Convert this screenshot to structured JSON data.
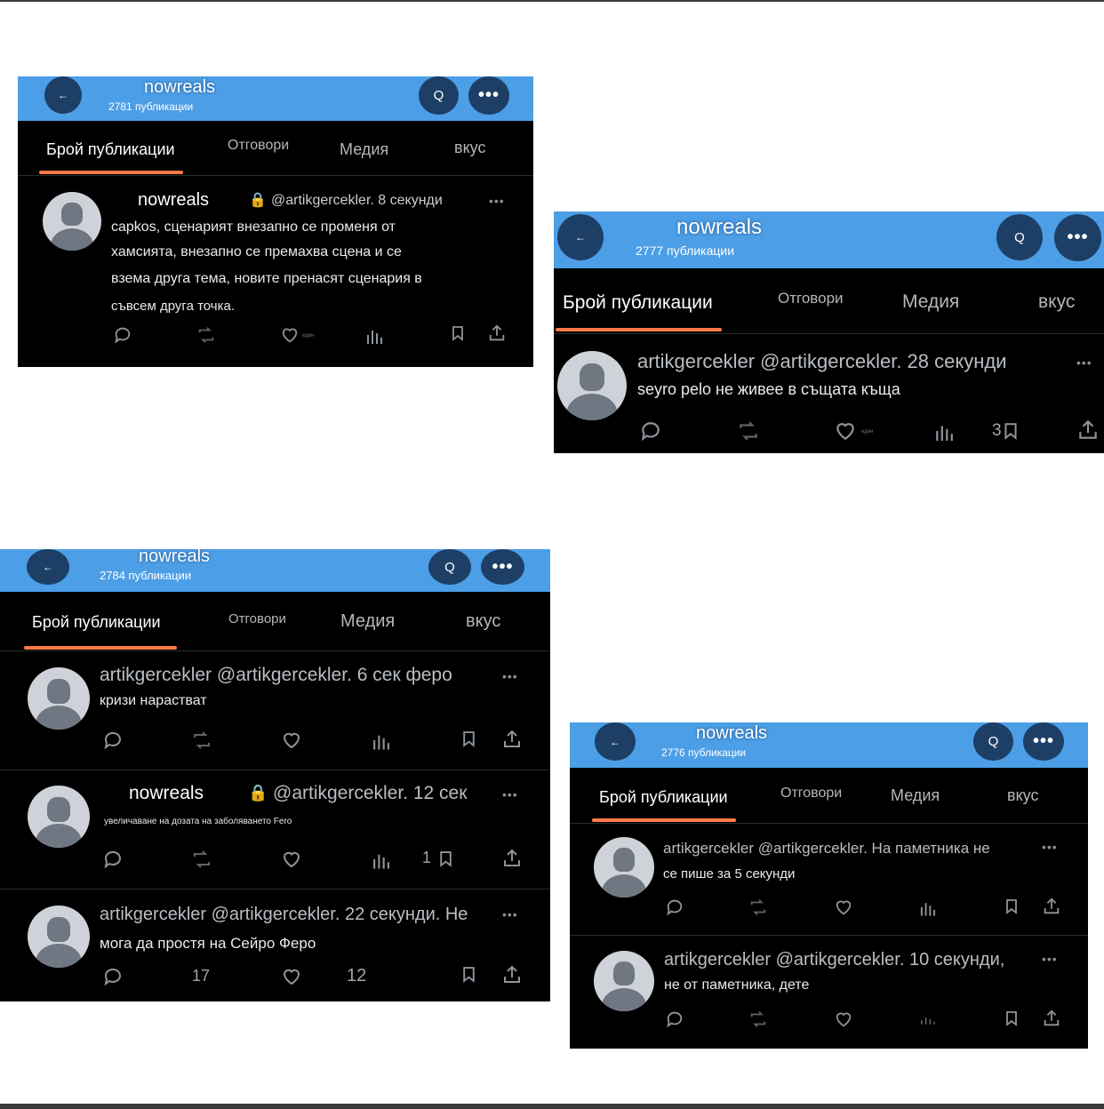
{
  "shots": [
    {
      "header": {
        "name": "nowreals",
        "count": "2781 публикации"
      },
      "tabs": [
        "Брой публикации",
        "Отговори",
        "Медия",
        "вкус"
      ],
      "posts": [
        {
          "name": "nowreals",
          "handle": "@artikgercekler. 8 секунди",
          "lines": [
            "capkos, сценарият внезапно се променя от",
            "хамсията, внезапно се премахва сцена и се",
            "взема друга тема, новите пренасят сценария в",
            "съвсем друга точка."
          ],
          "like_label": "един"
        }
      ]
    },
    {
      "header": {
        "name": "nowreals",
        "count": "2777 публикации"
      },
      "tabs": [
        "Брой публикации",
        "Отговори",
        "Медия",
        "вкус"
      ],
      "posts": [
        {
          "meta": "artikgercekler @artikgercekler. 28 секунди",
          "text": "seyro pelo не живее в същата къща",
          "like_label": "един",
          "bookmark_count": "3"
        }
      ]
    },
    {
      "header": {
        "name": "nowreals",
        "count": "2784 публикации"
      },
      "tabs": [
        "Брой публикации",
        "Отговори",
        "Медия",
        "вкус"
      ],
      "posts": [
        {
          "meta": "artikgercekler @artikgercekler. 6 сек феро",
          "text": "кризи нарастват"
        },
        {
          "name": "nowreals",
          "handle": "@artikgercekler. 12 сек",
          "text": "увеличаване на дозата на заболяването Fero",
          "bookmark_count": "1"
        },
        {
          "meta": "artikgercekler @artikgercekler. 22 секунди. Не",
          "text": "мога да простя на Сейро Феро",
          "retweet_count": "17",
          "views_count": "12"
        }
      ]
    },
    {
      "header": {
        "name": "nowreals",
        "count": "2776 публикации"
      },
      "tabs": [
        "Брой публикации",
        "Отговори",
        "Медия",
        "вкус"
      ],
      "posts": [
        {
          "meta": "artikgercekler @artikgercekler. На паметника не",
          "text": "се пише за 5 секунди"
        },
        {
          "meta": "artikgercekler @artikgercekler. 10 секунди,",
          "text": "не от паметника, дете"
        }
      ]
    }
  ],
  "icons": {
    "back": "←",
    "search": "Q",
    "more": "•••",
    "post_more": "•••"
  },
  "colors": {
    "header_blue": "#4c9ee6",
    "button_navy": "#1d3f66",
    "tab_indicator": "#ff7a45",
    "background": "#000000"
  }
}
